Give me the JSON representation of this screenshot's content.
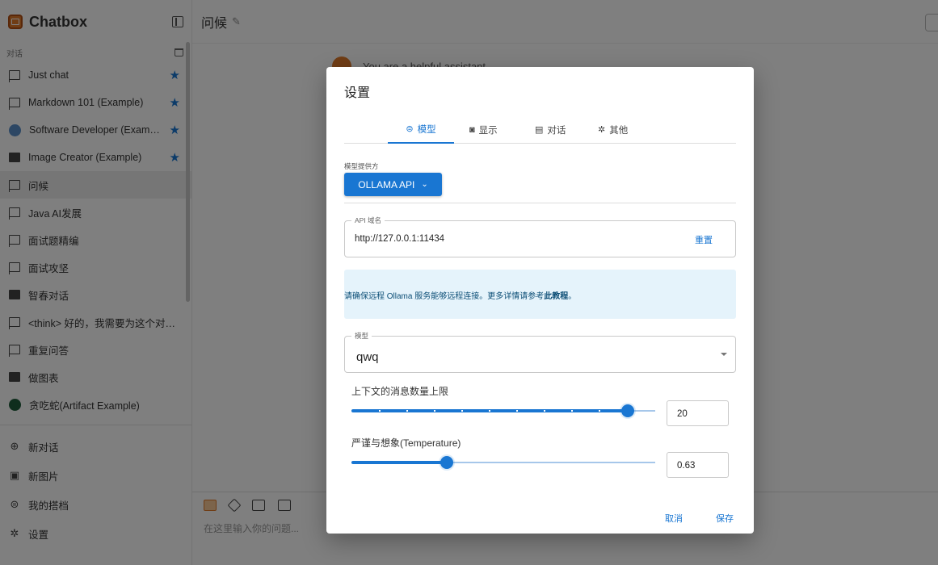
{
  "app": {
    "title": "Chatbox"
  },
  "sidebar": {
    "section_label": "对话",
    "items": [
      {
        "label": "Just chat",
        "icon": "chat-icon",
        "starred": true
      },
      {
        "label": "Markdown 101 (Example)",
        "icon": "chat-icon",
        "starred": true
      },
      {
        "label": "Software Developer (Exam…",
        "icon": "developer-avatar-icon",
        "starred": true
      },
      {
        "label": "Image Creator (Example)",
        "icon": "image-icon",
        "starred": true
      },
      {
        "label": "问候",
        "icon": "chat-icon",
        "starred": false,
        "active": true
      },
      {
        "label": "Java AI发展",
        "icon": "chat-icon",
        "starred": false
      },
      {
        "label": "面试题精编",
        "icon": "chat-icon",
        "starred": false
      },
      {
        "label": "面试攻坚",
        "icon": "chat-icon",
        "starred": false
      },
      {
        "label": "智春对话",
        "icon": "image-icon",
        "starred": false
      },
      {
        "label": "<think> 好的，我需要为这个对话…",
        "icon": "chat-icon",
        "starred": false
      },
      {
        "label": "重复问答",
        "icon": "chat-icon",
        "starred": false
      },
      {
        "label": "做图表",
        "icon": "chart-avatar-icon",
        "starred": false
      },
      {
        "label": "贪吃蛇(Artifact Example)",
        "icon": "snake-avatar-icon",
        "starred": false
      }
    ],
    "bottom": [
      {
        "label": "新对话",
        "icon": "plus-circle-icon"
      },
      {
        "label": "新图片",
        "icon": "image-plus-icon"
      },
      {
        "label": "我的搭档",
        "icon": "bot-icon"
      },
      {
        "label": "设置",
        "icon": "gear-icon"
      }
    ]
  },
  "main": {
    "chat_title": "问候",
    "system_message": "You are a helpful assistant.",
    "input_placeholder": "在这里输入你的问题..."
  },
  "dialog": {
    "title": "设置",
    "tabs": [
      {
        "label": "模型",
        "icon": "bot-icon",
        "active": true
      },
      {
        "label": "显示",
        "icon": "display-icon",
        "active": false
      },
      {
        "label": "对话",
        "icon": "chat-icon",
        "active": false
      },
      {
        "label": "其他",
        "icon": "gear-icon",
        "active": false
      }
    ],
    "provider_label": "模型提供方",
    "provider_value": "OLLAMA API",
    "host_label": "API 域名",
    "host_value": "http://127.0.0.1:11434",
    "reset_label": "重置",
    "info_text": "请确保远程 Ollama 服务能够远程连接。更多详情请参考",
    "info_link": "此教程",
    "info_end": "。",
    "model_label": "模型",
    "model_value": "qwq",
    "context_label": "上下文的消息数量上限",
    "context_value": "20",
    "context_fraction": 0.91,
    "temperature_label": "严谨与想象(Temperature)",
    "temperature_value": "0.63",
    "temperature_fraction": 0.315,
    "cancel_label": "取消",
    "save_label": "保存"
  },
  "colors": {
    "accent": "#1976d2",
    "brand": "#e07b2b",
    "info_bg": "#e5f3fb",
    "info_text": "#0c4e76"
  }
}
